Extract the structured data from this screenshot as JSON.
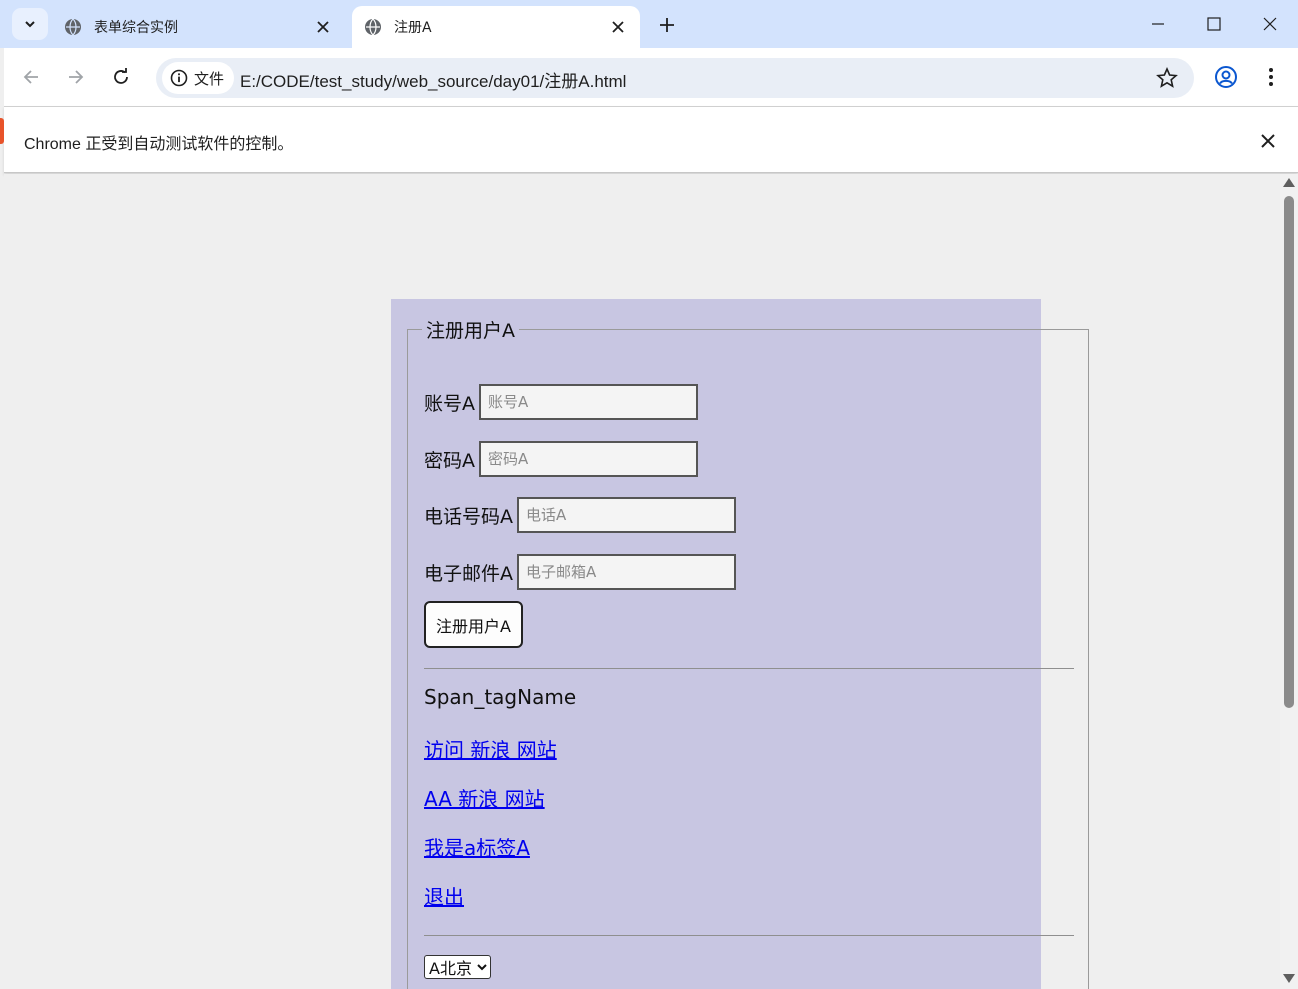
{
  "browser": {
    "tabs": [
      {
        "title": "表单综合实例",
        "active": false
      },
      {
        "title": "注册A",
        "active": true
      }
    ],
    "address": {
      "chip_label": "文件",
      "url": "E:/CODE/test_study/web_source/day01/注册A.html"
    },
    "infobar": {
      "message": "Chrome 正受到自动测试软件的控制。"
    }
  },
  "form": {
    "legend": "注册用户A",
    "fields": [
      {
        "label": "账号A",
        "placeholder": "账号A"
      },
      {
        "label": "密码A",
        "placeholder": "密码A"
      },
      {
        "label": "电话号码A",
        "placeholder": "电话A"
      },
      {
        "label": "电子邮件A",
        "placeholder": "电子邮箱A"
      }
    ],
    "submit_label": "注册用户A"
  },
  "content": {
    "span_text": "Span_tagName",
    "links": [
      "访问 新浪 网站",
      "AA 新浪 网站",
      "我是a标签A",
      "退出"
    ],
    "select_value": "A北京"
  },
  "colors": {
    "tabstrip": "#d3e3fd",
    "page_panel": "#c8c6e2",
    "link": "#0000ee"
  }
}
